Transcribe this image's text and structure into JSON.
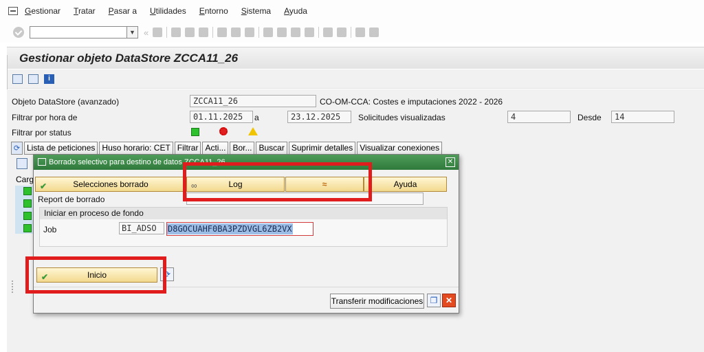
{
  "menubar": {
    "items": [
      {
        "name": "menu-gestionar",
        "ul": "G",
        "rest": "estionar"
      },
      {
        "name": "menu-tratar",
        "ul": "T",
        "rest": "ratar"
      },
      {
        "name": "menu-pasar-a",
        "ul": "P",
        "rest": "asar a"
      },
      {
        "name": "menu-utilidades",
        "ul": "U",
        "rest": "tilidades"
      },
      {
        "name": "menu-entorno",
        "ul": "E",
        "rest": "ntorno"
      },
      {
        "name": "menu-sistema",
        "ul": "S",
        "rest": "istema"
      },
      {
        "name": "menu-ayuda",
        "ul": "A",
        "rest": "yuda"
      }
    ]
  },
  "toolbar": {
    "command_value": "",
    "back_glyph": "«"
  },
  "page": {
    "title": "Gestionar objeto DataStore ZCCA11_26"
  },
  "form": {
    "objeto_label": "Objeto DataStore (avanzado)",
    "objeto_value": "ZCCA11_26",
    "objeto_desc": "CO-OM-CCA: Costes e imputaciones 2022 - 2026",
    "filtrar_hora_label": "Filtrar por hora de",
    "fecha_desde": "01.11.2025",
    "a_label": "a",
    "fecha_hasta": "23.12.2025",
    "solicitudes_label": "Solicitudes visualizadas",
    "solicitudes_value": "4",
    "desde_label": "Desde",
    "desde_value": "14",
    "filtrar_status_label": "Filtrar por status"
  },
  "buttons": {
    "lista": "Lista de peticiones",
    "huso": "Huso horario: CET",
    "filtrar": "Filtrar",
    "acti": "Acti...",
    "bor": "Bor...",
    "buscar": "Buscar",
    "suprimir": "Suprimir detalles",
    "visualizar": "Visualizar conexiones"
  },
  "left": {
    "carg": "Carg"
  },
  "dialog": {
    "title": "Borrado selectivo para destino de datos ZCCA11_26",
    "selecciones": "Selecciones borrado",
    "log": "Log",
    "ayuda": "Ayuda",
    "report_label": "Report de borrado",
    "group_title": "Iniciar en proceso de fondo",
    "job_label": "Job",
    "job_prefix": "BI_ADSO",
    "job_id": "D8GOCUAHF0BA3PZDVGL6ZB2VX",
    "inicio": "Inicio",
    "transferir": "Transferir modificaciones"
  },
  "colors": {
    "highlight": "#e01c1c",
    "dialog_title": "#2f7a3b",
    "accent_button": "#f2d98e"
  }
}
